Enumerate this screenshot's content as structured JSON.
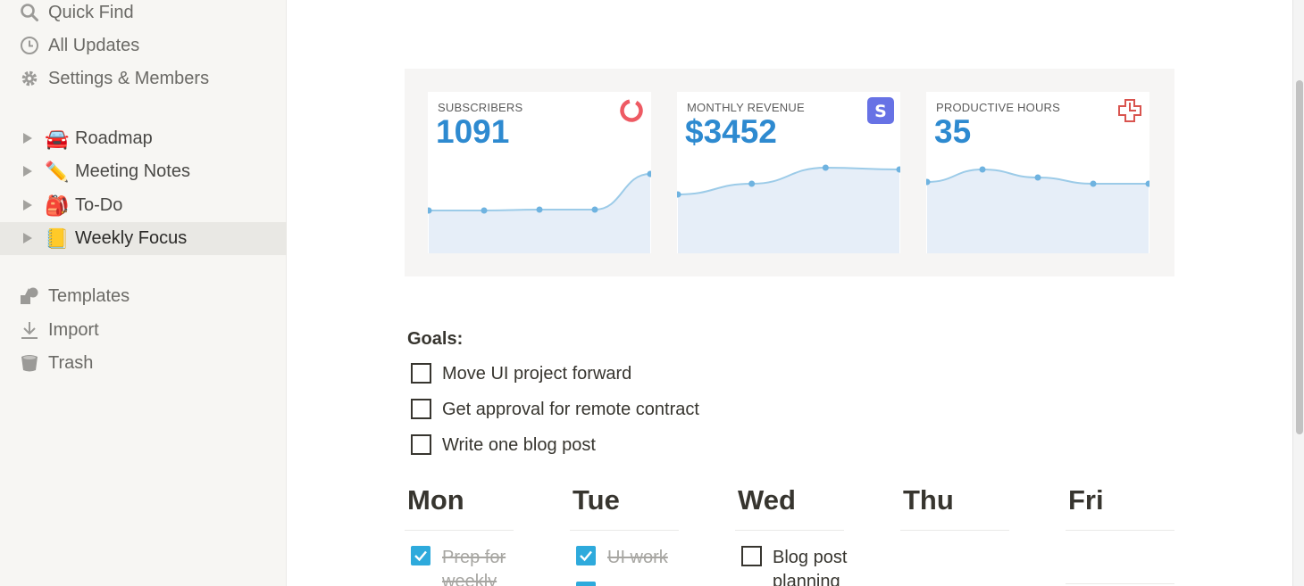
{
  "sidebar": {
    "nav": [
      {
        "label": "Quick Find",
        "icon": "search-icon"
      },
      {
        "label": "All Updates",
        "icon": "clock-icon"
      },
      {
        "label": "Settings & Members",
        "icon": "gear-icon"
      }
    ],
    "pages": [
      {
        "label": "Roadmap",
        "emoji": "🚘"
      },
      {
        "label": "Meeting Notes",
        "emoji": "✏️"
      },
      {
        "label": "To-Do",
        "emoji": "🎒"
      },
      {
        "label": "Weekly Focus",
        "emoji": "📒",
        "active": true
      }
    ],
    "footer": [
      {
        "label": "Templates",
        "icon": "shapes-icon"
      },
      {
        "label": "Import",
        "icon": "download-icon"
      },
      {
        "label": "Trash",
        "icon": "trash-icon"
      }
    ]
  },
  "stats": [
    {
      "label": "SUBSCRIBERS",
      "value": "1091",
      "icon": "ring-logo-icon",
      "trend": [
        236,
        236,
        235,
        235,
        195
      ]
    },
    {
      "label": "MONTHLY REVENUE",
      "value": "$3452",
      "icon": "stripe-logo-icon",
      "trend": [
        218,
        206,
        188,
        190
      ]
    },
    {
      "label": "PRODUCTIVE HOURS",
      "value": "35",
      "icon": "health-cross-icon",
      "trend": [
        204,
        190,
        199,
        206,
        206
      ]
    }
  ],
  "goals": {
    "title": "Goals:",
    "items": [
      {
        "text": "Move UI project forward",
        "checked": false
      },
      {
        "text": "Get approval for remote contract",
        "checked": false
      },
      {
        "text": "Write one blog post",
        "checked": false
      }
    ]
  },
  "week": {
    "days": [
      "Mon",
      "Tue",
      "Wed",
      "Thu",
      "Fri"
    ],
    "tasks": [
      {
        "text": "Prep for weekly",
        "checked": true
      },
      {
        "text": "UI work",
        "checked": true
      },
      {
        "text": "Blog post planning",
        "checked": false
      }
    ]
  },
  "colors": {
    "accent": "#2e8ad0",
    "check": "#2eaadc",
    "sparkline": "#9ccbe8",
    "sparkfill": "#e6eef8"
  }
}
